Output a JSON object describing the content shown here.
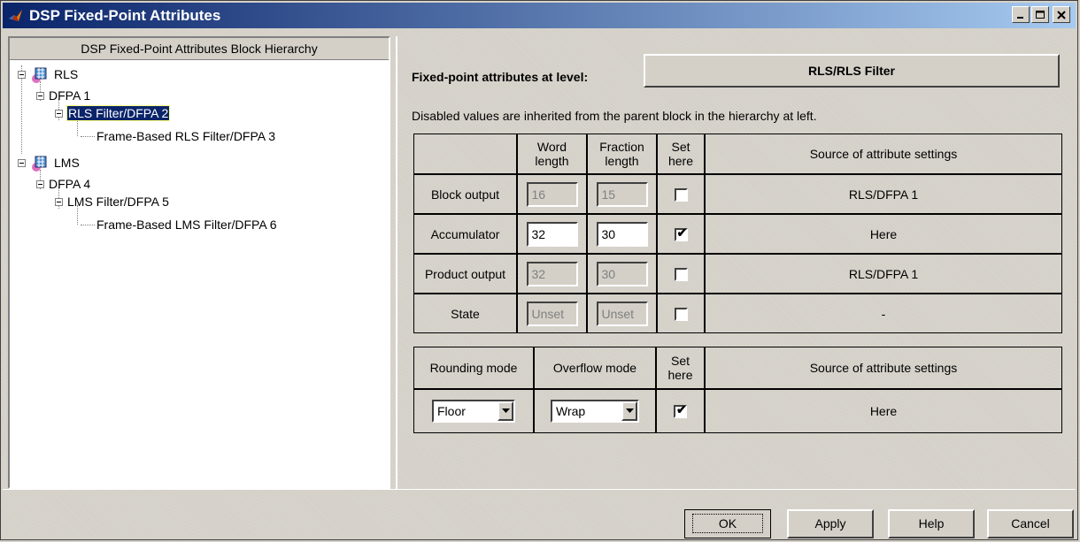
{
  "window": {
    "title": "DSP Fixed-Point Attributes",
    "controls": [
      "minimize-icon",
      "maximize-icon",
      "close-icon"
    ]
  },
  "tree": {
    "header": "DSP Fixed-Point Attributes Block Hierarchy",
    "nodes": [
      {
        "label": "RLS",
        "icon": "model-block-icon"
      },
      {
        "label": "DFPA 1"
      },
      {
        "label": "RLS Filter/DFPA 2",
        "selected": true
      },
      {
        "label": "Frame-Based RLS Filter/DFPA 3"
      },
      {
        "label": "LMS",
        "icon": "model-block-icon"
      },
      {
        "label": "DFPA 4"
      },
      {
        "label": "LMS Filter/DFPA 5"
      },
      {
        "label": "Frame-Based LMS Filter/DFPA 6"
      }
    ]
  },
  "level": {
    "label": "Fixed-point attributes at level:",
    "value": "RLS/RLS Filter"
  },
  "info_text": "Disabled values are inherited from the parent block in the hierarchy at left.",
  "attributes_table": {
    "headers": {
      "word_length": [
        "Word",
        "length"
      ],
      "fraction_length": [
        "Fraction",
        "length"
      ],
      "set_here": [
        "Set",
        "here"
      ],
      "source": "Source of attribute settings"
    },
    "rows": [
      {
        "name": "Block output",
        "word": "16",
        "fraction": "15",
        "checked": false,
        "enabled": false,
        "source": "RLS/DFPA 1"
      },
      {
        "name": "Accumulator",
        "word": "32",
        "fraction": "30",
        "checked": true,
        "enabled": true,
        "source": "Here"
      },
      {
        "name": "Product output",
        "word": "32",
        "fraction": "30",
        "checked": false,
        "enabled": false,
        "source": "RLS/DFPA 1"
      },
      {
        "name": "State",
        "word": "Unset",
        "fraction": "Unset",
        "checked": false,
        "enabled": false,
        "source": "-"
      }
    ]
  },
  "mode_table": {
    "headers": {
      "rounding": "Rounding mode",
      "overflow": "Overflow mode",
      "set_here": [
        "Set",
        "here"
      ],
      "source": "Source of attribute settings"
    },
    "rounding_value": "Floor",
    "overflow_value": "Wrap",
    "checked": true,
    "source": "Here"
  },
  "buttons": {
    "ok": "OK",
    "apply": "Apply",
    "help": "Help",
    "cancel": "Cancel"
  }
}
